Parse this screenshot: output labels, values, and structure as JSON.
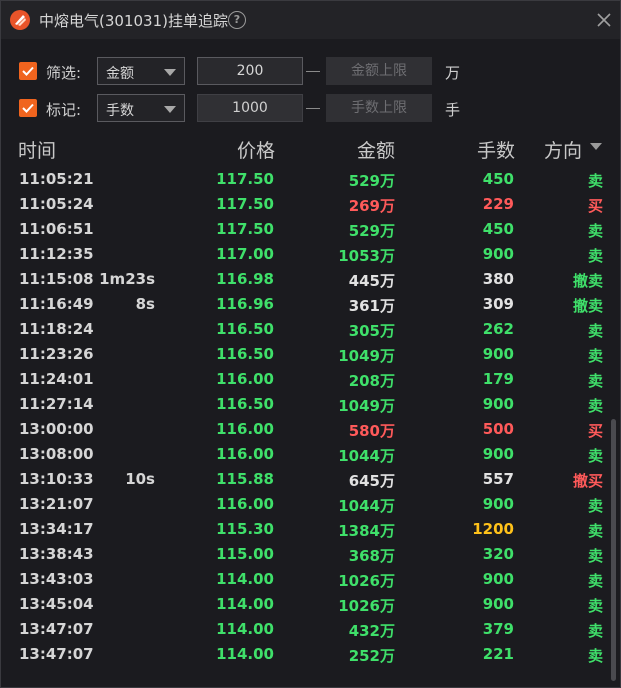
{
  "window": {
    "title": "中熔电气(301031)挂单追踪",
    "help": "?"
  },
  "colors": {
    "accent": "#f0641e",
    "buy": "#ff5a5a",
    "sell": "#3fe06a",
    "neutral": "#e2e2e2",
    "highlight": "#ffc21a"
  },
  "filter": {
    "label": "筛选:",
    "checked": true,
    "select_value": "金额",
    "min_value": "200",
    "max_placeholder": "金额上限",
    "unit": "万"
  },
  "mark": {
    "label": "标记:",
    "checked": true,
    "select_value": "手数",
    "min_value": "1000",
    "max_placeholder": "手数上限",
    "unit": "手"
  },
  "table": {
    "headers": {
      "time": "时间",
      "price": "价格",
      "amount": "金额",
      "volume": "手数",
      "direction": "方向"
    },
    "rows": [
      {
        "time": "11:05:21",
        "dur": "",
        "price": "117.50",
        "amount": "529万",
        "vol": "450",
        "dir": "卖",
        "pc": "green",
        "ac": "green",
        "vc": "green",
        "dc": "green"
      },
      {
        "time": "11:05:24",
        "dur": "",
        "price": "117.50",
        "amount": "269万",
        "vol": "229",
        "dir": "买",
        "pc": "green",
        "ac": "red",
        "vc": "red",
        "dc": "red"
      },
      {
        "time": "11:06:51",
        "dur": "",
        "price": "117.50",
        "amount": "529万",
        "vol": "450",
        "dir": "卖",
        "pc": "green",
        "ac": "green",
        "vc": "green",
        "dc": "green"
      },
      {
        "time": "11:12:35",
        "dur": "",
        "price": "117.00",
        "amount": "1053万",
        "vol": "900",
        "dir": "卖",
        "pc": "green",
        "ac": "green",
        "vc": "green",
        "dc": "green"
      },
      {
        "time": "11:15:08",
        "dur": "1m23s",
        "price": "116.98",
        "amount": "445万",
        "vol": "380",
        "dir": "撤卖",
        "pc": "green",
        "ac": "white",
        "vc": "white",
        "dc": "green"
      },
      {
        "time": "11:16:49",
        "dur": "8s",
        "price": "116.96",
        "amount": "361万",
        "vol": "309",
        "dir": "撤卖",
        "pc": "green",
        "ac": "white",
        "vc": "white",
        "dc": "green"
      },
      {
        "time": "11:18:24",
        "dur": "",
        "price": "116.50",
        "amount": "305万",
        "vol": "262",
        "dir": "卖",
        "pc": "green",
        "ac": "green",
        "vc": "green",
        "dc": "green"
      },
      {
        "time": "11:23:26",
        "dur": "",
        "price": "116.50",
        "amount": "1049万",
        "vol": "900",
        "dir": "卖",
        "pc": "green",
        "ac": "green",
        "vc": "green",
        "dc": "green"
      },
      {
        "time": "11:24:01",
        "dur": "",
        "price": "116.00",
        "amount": "208万",
        "vol": "179",
        "dir": "卖",
        "pc": "green",
        "ac": "green",
        "vc": "green",
        "dc": "green"
      },
      {
        "time": "11:27:14",
        "dur": "",
        "price": "116.50",
        "amount": "1049万",
        "vol": "900",
        "dir": "卖",
        "pc": "green",
        "ac": "green",
        "vc": "green",
        "dc": "green"
      },
      {
        "time": "13:00:00",
        "dur": "",
        "price": "116.00",
        "amount": "580万",
        "vol": "500",
        "dir": "买",
        "pc": "green",
        "ac": "red",
        "vc": "red",
        "dc": "red"
      },
      {
        "time": "13:08:00",
        "dur": "",
        "price": "116.00",
        "amount": "1044万",
        "vol": "900",
        "dir": "卖",
        "pc": "green",
        "ac": "green",
        "vc": "green",
        "dc": "green"
      },
      {
        "time": "13:10:33",
        "dur": "10s",
        "price": "115.88",
        "amount": "645万",
        "vol": "557",
        "dir": "撤买",
        "pc": "green",
        "ac": "white",
        "vc": "white",
        "dc": "red"
      },
      {
        "time": "13:21:07",
        "dur": "",
        "price": "116.00",
        "amount": "1044万",
        "vol": "900",
        "dir": "卖",
        "pc": "green",
        "ac": "green",
        "vc": "green",
        "dc": "green"
      },
      {
        "time": "13:34:17",
        "dur": "",
        "price": "115.30",
        "amount": "1384万",
        "vol": "1200",
        "dir": "卖",
        "pc": "green",
        "ac": "green",
        "vc": "yellow",
        "dc": "green"
      },
      {
        "time": "13:38:43",
        "dur": "",
        "price": "115.00",
        "amount": "368万",
        "vol": "320",
        "dir": "卖",
        "pc": "green",
        "ac": "green",
        "vc": "green",
        "dc": "green"
      },
      {
        "time": "13:43:03",
        "dur": "",
        "price": "114.00",
        "amount": "1026万",
        "vol": "900",
        "dir": "卖",
        "pc": "green",
        "ac": "green",
        "vc": "green",
        "dc": "green"
      },
      {
        "time": "13:45:04",
        "dur": "",
        "price": "114.00",
        "amount": "1026万",
        "vol": "900",
        "dir": "卖",
        "pc": "green",
        "ac": "green",
        "vc": "green",
        "dc": "green"
      },
      {
        "time": "13:47:07",
        "dur": "",
        "price": "114.00",
        "amount": "432万",
        "vol": "379",
        "dir": "卖",
        "pc": "green",
        "ac": "green",
        "vc": "green",
        "dc": "green"
      },
      {
        "time": "13:47:07",
        "dur": "",
        "price": "114.00",
        "amount": "252万",
        "vol": "221",
        "dir": "卖",
        "pc": "green",
        "ac": "green",
        "vc": "green",
        "dc": "green"
      }
    ]
  }
}
